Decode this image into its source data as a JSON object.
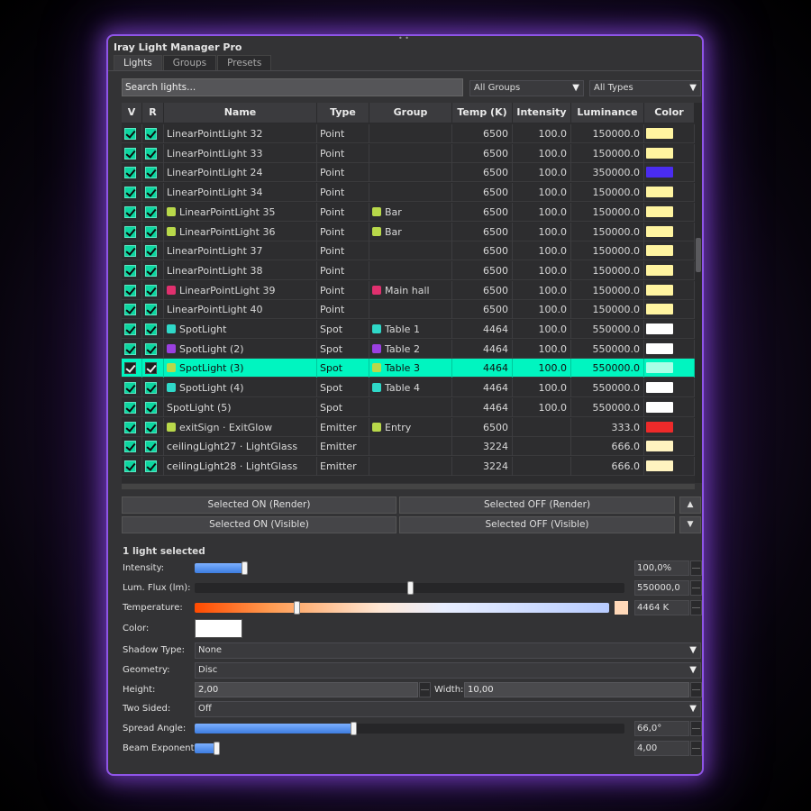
{
  "window": {
    "title": "Iray Light Manager Pro",
    "accent": "#8f55e8"
  },
  "tabs": [
    {
      "label": "Lights",
      "active": true
    },
    {
      "label": "Groups",
      "active": false
    },
    {
      "label": "Presets",
      "active": false
    }
  ],
  "search": {
    "placeholder": "Search lights...",
    "value": ""
  },
  "filters": {
    "group": "All Groups",
    "type": "All Types"
  },
  "table": {
    "columns": [
      "V",
      "R",
      "Name",
      "Type",
      "Group",
      "Temp (K)",
      "Intensity",
      "Luminance",
      "Color"
    ],
    "rows": [
      {
        "v": true,
        "r": true,
        "name": "LinearPointLight 32",
        "dot": null,
        "type": "Point",
        "group": "",
        "gdot": null,
        "temp": "6500",
        "intensity": "100.0",
        "luminance": "150000.0",
        "color": "#fff4a0",
        "selected": false
      },
      {
        "v": true,
        "r": true,
        "name": "LinearPointLight 33",
        "dot": null,
        "type": "Point",
        "group": "",
        "gdot": null,
        "temp": "6500",
        "intensity": "100.0",
        "luminance": "150000.0",
        "color": "#fff4a0",
        "selected": false
      },
      {
        "v": true,
        "r": true,
        "name": "LinearPointLight 24",
        "dot": null,
        "type": "Point",
        "group": "",
        "gdot": null,
        "temp": "6500",
        "intensity": "100.0",
        "luminance": "350000.0",
        "color": "#4a2cf0",
        "selected": false
      },
      {
        "v": true,
        "r": true,
        "name": "LinearPointLight 34",
        "dot": null,
        "type": "Point",
        "group": "",
        "gdot": null,
        "temp": "6500",
        "intensity": "100.0",
        "luminance": "150000.0",
        "color": "#fff4a0",
        "selected": false
      },
      {
        "v": true,
        "r": true,
        "name": "LinearPointLight 35",
        "dot": "#b8d84a",
        "type": "Point",
        "group": "Bar",
        "gdot": "#b8d84a",
        "temp": "6500",
        "intensity": "100.0",
        "luminance": "150000.0",
        "color": "#fff4a0",
        "selected": false
      },
      {
        "v": true,
        "r": true,
        "name": "LinearPointLight 36",
        "dot": "#b8d84a",
        "type": "Point",
        "group": "Bar",
        "gdot": "#b8d84a",
        "temp": "6500",
        "intensity": "100.0",
        "luminance": "150000.0",
        "color": "#fff4a0",
        "selected": false
      },
      {
        "v": true,
        "r": true,
        "name": "LinearPointLight 37",
        "dot": null,
        "type": "Point",
        "group": "",
        "gdot": null,
        "temp": "6500",
        "intensity": "100.0",
        "luminance": "150000.0",
        "color": "#fff4a0",
        "selected": false
      },
      {
        "v": true,
        "r": true,
        "name": "LinearPointLight 38",
        "dot": null,
        "type": "Point",
        "group": "",
        "gdot": null,
        "temp": "6500",
        "intensity": "100.0",
        "luminance": "150000.0",
        "color": "#fff4a0",
        "selected": false
      },
      {
        "v": true,
        "r": true,
        "name": "LinearPointLight 39",
        "dot": "#e0306e",
        "type": "Point",
        "group": "Main hall",
        "gdot": "#e0306e",
        "temp": "6500",
        "intensity": "100.0",
        "luminance": "150000.0",
        "color": "#fff4a0",
        "selected": false
      },
      {
        "v": true,
        "r": true,
        "name": "LinearPointLight 40",
        "dot": null,
        "type": "Point",
        "group": "",
        "gdot": null,
        "temp": "6500",
        "intensity": "100.0",
        "luminance": "150000.0",
        "color": "#fff4a0",
        "selected": false
      },
      {
        "v": true,
        "r": true,
        "name": "SpotLight",
        "dot": "#2fd8c8",
        "type": "Spot",
        "group": "Table 1",
        "gdot": "#2fd8c8",
        "temp": "4464",
        "intensity": "100.0",
        "luminance": "550000.0",
        "color": "#ffffff",
        "selected": false
      },
      {
        "v": true,
        "r": true,
        "name": "SpotLight (2)",
        "dot": "#9a40e0",
        "type": "Spot",
        "group": "Table 2",
        "gdot": "#9a40e0",
        "temp": "4464",
        "intensity": "100.0",
        "luminance": "550000.0",
        "color": "#ffffff",
        "selected": false
      },
      {
        "v": true,
        "r": true,
        "name": "SpotLight (3)",
        "dot": "#b8d84a",
        "type": "Spot",
        "group": "Table 3",
        "gdot": "#b8d84a",
        "temp": "4464",
        "intensity": "100.0",
        "luminance": "550000.0",
        "color": "#a8ffe6",
        "selected": true
      },
      {
        "v": true,
        "r": true,
        "name": "SpotLight (4)",
        "dot": "#2fd8c8",
        "type": "Spot",
        "group": "Table 4",
        "gdot": "#2fd8c8",
        "temp": "4464",
        "intensity": "100.0",
        "luminance": "550000.0",
        "color": "#ffffff",
        "selected": false
      },
      {
        "v": true,
        "r": true,
        "name": "SpotLight (5)",
        "dot": null,
        "type": "Spot",
        "group": "",
        "gdot": null,
        "temp": "4464",
        "intensity": "100.0",
        "luminance": "550000.0",
        "color": "#ffffff",
        "selected": false
      },
      {
        "v": true,
        "r": true,
        "name": "exitSign · ExitGlow",
        "dot": "#b8d84a",
        "type": "Emitter",
        "group": "Entry",
        "gdot": "#b8d84a",
        "temp": "6500",
        "intensity": "",
        "luminance": "333.0",
        "color": "#ee2a2a",
        "selected": false
      },
      {
        "v": true,
        "r": true,
        "name": "ceilingLight27 · LightGlass",
        "dot": null,
        "type": "Emitter",
        "group": "",
        "gdot": null,
        "temp": "3224",
        "intensity": "",
        "luminance": "666.0",
        "color": "#fff3c0",
        "selected": false
      },
      {
        "v": true,
        "r": true,
        "name": "ceilingLight28 · LightGlass",
        "dot": null,
        "type": "Emitter",
        "group": "",
        "gdot": null,
        "temp": "3224",
        "intensity": "",
        "luminance": "666.0",
        "color": "#fff3c0",
        "selected": false
      }
    ]
  },
  "actions": {
    "on_render": "Selected ON (Render)",
    "off_render": "Selected OFF (Render)",
    "on_visible": "Selected ON (Visible)",
    "off_visible": "Selected OFF (Visible)",
    "up_icon": "▲",
    "down_icon": "▼"
  },
  "props": {
    "selected_count": "1 light selected",
    "intensity": {
      "label": "Intensity:",
      "value": "100,0%",
      "level": 0.25
    },
    "flux": {
      "label": "Lum. Flux (lm):",
      "value": "550000,0",
      "level": 0.5
    },
    "temperature": {
      "label": "Temperature:",
      "value": "4464 K",
      "level": 0.245,
      "swatch": "#ffd8b8"
    },
    "color": {
      "label": "Color:",
      "value": "#ffffff"
    },
    "shadow": {
      "label": "Shadow Type:",
      "value": "None"
    },
    "geometry": {
      "label": "Geometry:",
      "value": "Disc"
    },
    "height": {
      "label": "Height:",
      "value": "2,00"
    },
    "width": {
      "label": "Width:",
      "value": "10,00"
    },
    "two_sided": {
      "label": "Two Sided:",
      "value": "Off"
    },
    "spread": {
      "label": "Spread Angle:",
      "value": "66,0°",
      "level": 0.37
    },
    "beam": {
      "label": "Beam Exponent:",
      "value": "4,00",
      "level": 0.04
    }
  }
}
